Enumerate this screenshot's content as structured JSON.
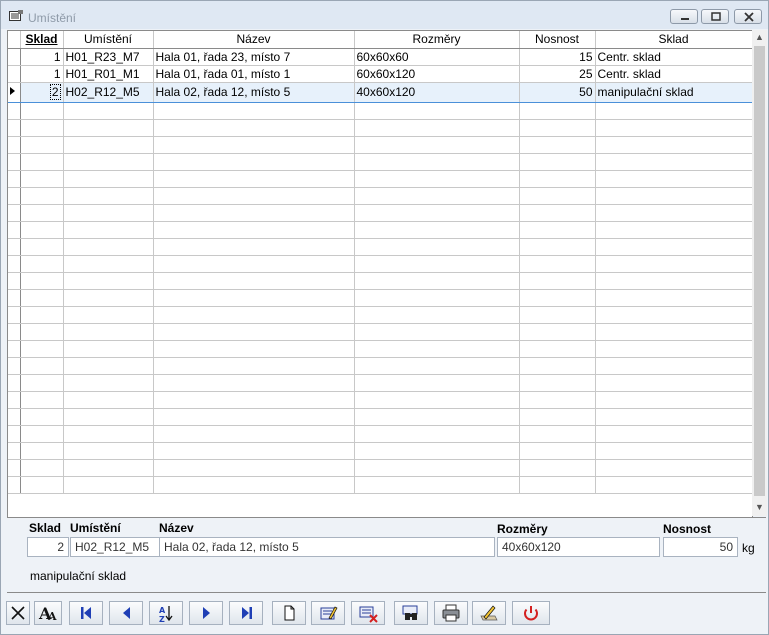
{
  "window": {
    "title": "Umístění"
  },
  "grid": {
    "columns": [
      "Sklad",
      "Umístění",
      "Název",
      "Rozměry",
      "Nosnost",
      "Sklad"
    ],
    "rows": [
      [
        "1",
        "H01_R23_M7",
        "Hala 01, řada 23, místo 7",
        "60x60x60",
        "15",
        "Centr. sklad"
      ],
      [
        "1",
        "H01_R01_M1",
        "Hala 01, řada 01, místo 1",
        "60x60x120",
        "25",
        "Centr. sklad"
      ],
      [
        "2",
        "H02_R12_M5",
        "Hala 02, řada 12, místo 5",
        "40x60x120",
        "50",
        "manipulační sklad"
      ]
    ],
    "selected_row": 2
  },
  "detail": {
    "labels": {
      "sklad": "Sklad",
      "umisteni": "Umístění",
      "nazev": "Název",
      "rozmery": "Rozměry",
      "nosnost": "Nosnost"
    },
    "values": {
      "sklad": "2",
      "umisteni": "H02_R12_M5",
      "nazev": "Hala 02, řada 12, místo 5",
      "rozmery": "40x60x120",
      "nosnost": "50"
    },
    "unit": "kg",
    "sklad_name": "manipulační sklad"
  },
  "toolbar": {
    "buttons": [
      "close-icon",
      "font-icon",
      "first-record-icon",
      "previous-record-icon",
      "sort-az-icon",
      "next-record-icon",
      "last-record-icon",
      "new-record-icon",
      "edit-record-icon",
      "delete-record-icon",
      "find-icon",
      "print-icon",
      "edit-pencil-icon",
      "power-icon"
    ]
  },
  "colors": {
    "selection": "#e7f1fb",
    "selection_border": "#4a90d9",
    "nav_blue": "#1f3fb5",
    "power_red": "#d42020"
  }
}
